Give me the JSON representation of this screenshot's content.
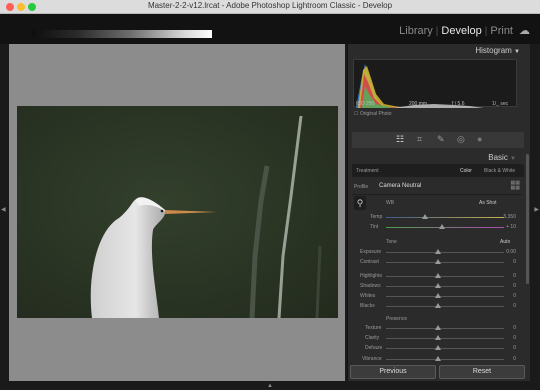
{
  "window": {
    "title": "Master-2-2-v12.lrcat - Adobe Photoshop Lightroom Classic - Develop"
  },
  "modules": {
    "library": "Library",
    "develop": "Develop",
    "print": "Print",
    "cloud_icon": "cloud-icon"
  },
  "histogram": {
    "header": "Histogram",
    "info_left": "ISO 250",
    "info_mid": "200 mm",
    "info_right": "f / 5.6",
    "info_far": "1/_ sec",
    "original_photo": "Original Photo"
  },
  "basic": {
    "header": "Basic",
    "treatment_label": "Treatment",
    "treatment_color": "Color",
    "treatment_bw": "Black & White",
    "profile_label": "Profile",
    "profile_value": "Camera Neutral",
    "wb_label": "WB",
    "wb_value": "As Shot",
    "temp_label": "Temp",
    "temp_value": "5,350",
    "tint_label": "Tint",
    "tint_value": "+ 10",
    "tone_label": "Tone",
    "auto_label": "Auto",
    "exposure_label": "Exposure",
    "exposure_value": "0.00",
    "contrast_label": "Contrast",
    "contrast_value": "0",
    "highlights_label": "Highlights",
    "highlights_value": "0",
    "shadows_label": "Shadows",
    "shadows_value": "0",
    "whites_label": "Whites",
    "whites_value": "0",
    "blacks_label": "Blacks",
    "blacks_value": "0",
    "presence_label": "Presence",
    "texture_label": "Texture",
    "texture_value": "0",
    "clarity_label": "Clarity",
    "clarity_value": "0",
    "dehaze_label": "Dehaze",
    "dehaze_value": "0",
    "vibrance_label": "Vibrance",
    "vibrance_value": "0"
  },
  "buttons": {
    "previous": "Previous",
    "reset": "Reset"
  },
  "colors": {
    "panel_bg": "#2b2b2b",
    "photo_bg": "#8c8c8c",
    "topbar_bg": "#121212"
  }
}
